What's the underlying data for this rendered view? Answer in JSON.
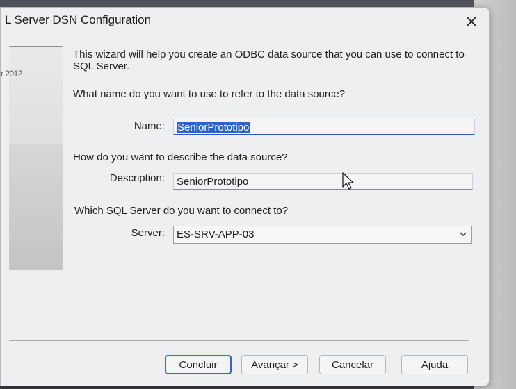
{
  "window": {
    "title": "L Server DSN Configuration"
  },
  "side_panel": {
    "text": "r 2012"
  },
  "intro": {
    "text": "This wizard will help you create an ODBC data source that you can use to connect to SQL Server."
  },
  "name_section": {
    "question": "What name do you want to use to refer to the data source?",
    "label": "Name:",
    "value": "SeniorPrototipo"
  },
  "description_section": {
    "question": "How do you want to describe the data source?",
    "label": "Description:",
    "value": "SeniorPrototipo"
  },
  "server_section": {
    "question": "Which SQL Server do you want to connect to?",
    "label": "Server:",
    "value": "ES-SRV-APP-03"
  },
  "buttons": {
    "finish": "Concluir",
    "next": "Avançar >",
    "cancel": "Cancelar",
    "help": "Ajuda"
  },
  "colors": {
    "accent": "#2f62c9",
    "dialog_bg": "#eeeff1"
  },
  "icons": [
    "close-icon",
    "chevron-down-icon",
    "mouse-pointer-icon"
  ]
}
